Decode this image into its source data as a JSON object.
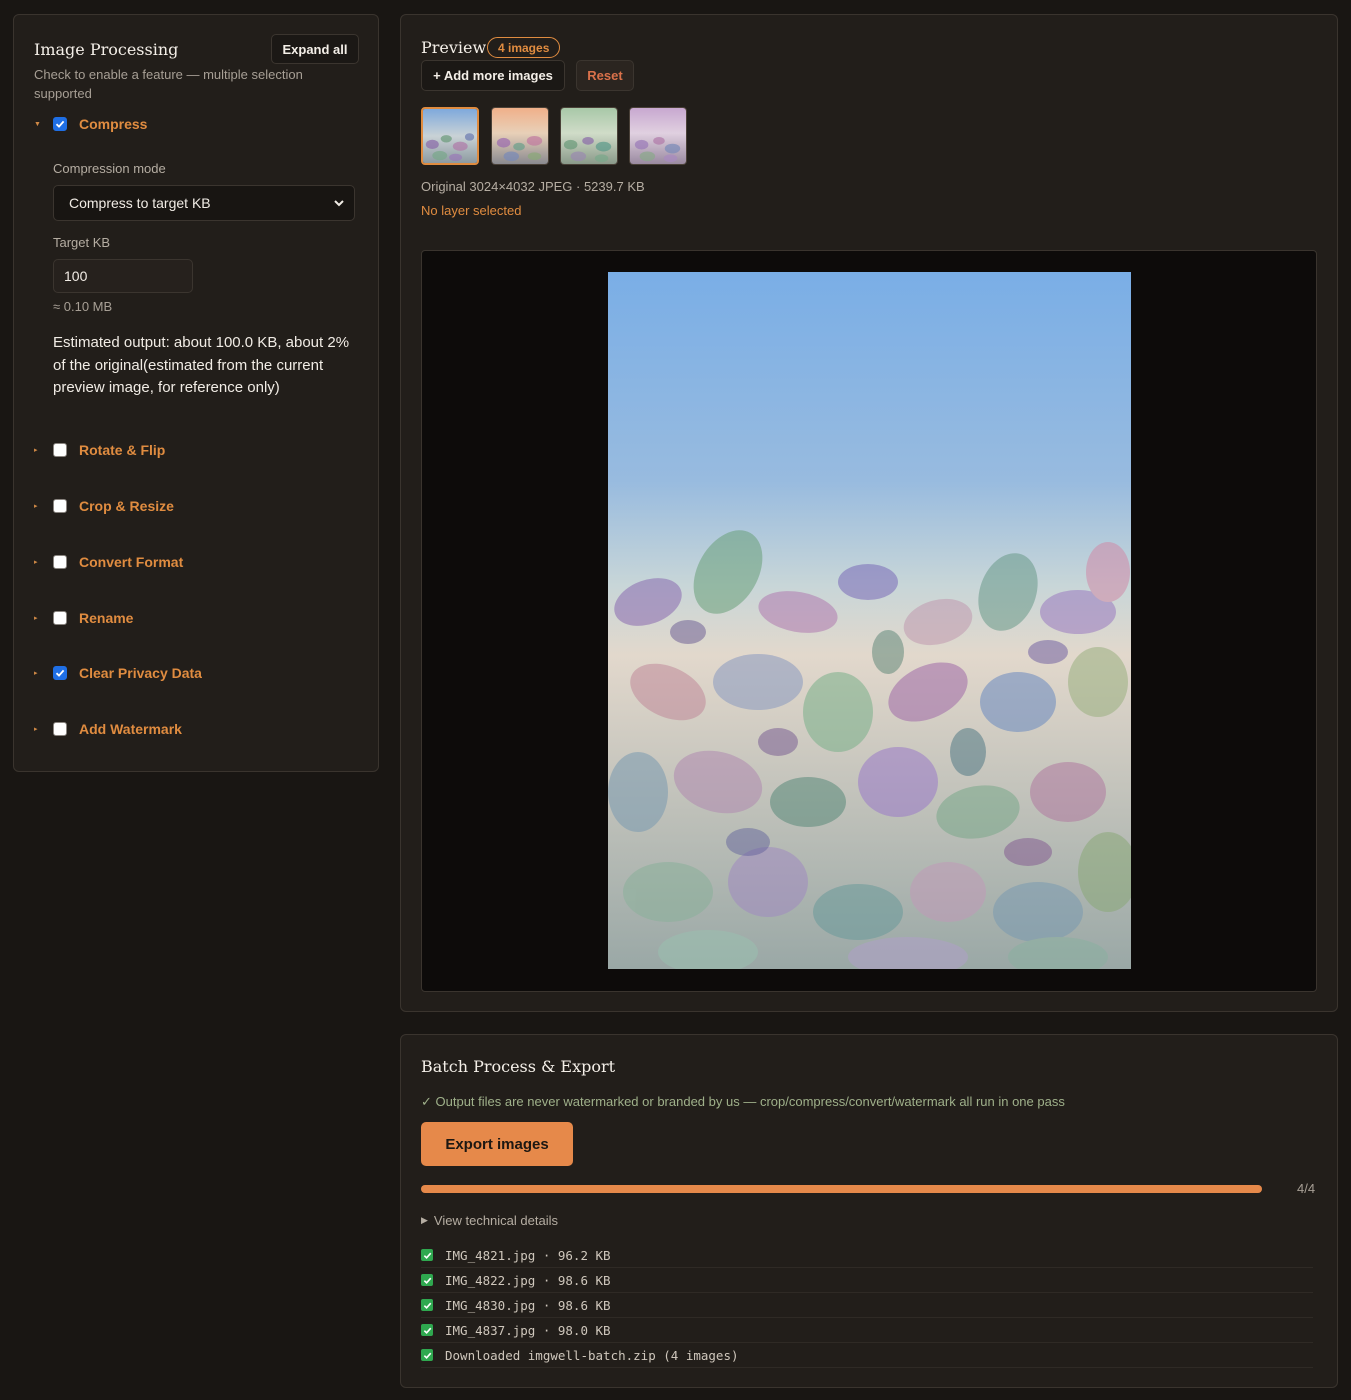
{
  "left_panel": {
    "title": "Image Processing",
    "expand_all_label": "Expand all",
    "hint": "Check to enable a feature — multiple selection supported",
    "compress": {
      "label": "Compress",
      "checked": true,
      "mode_label": "Compression mode",
      "mode_value": "Compress to target KB",
      "target_label": "Target KB",
      "target_value": "100",
      "mb_hint": "≈ 0.10 MB",
      "estimate": "Estimated output: about 100.0 KB, about 2% of the original(estimated from the current preview image, for reference only)"
    },
    "features": [
      {
        "label": "Rotate & Flip",
        "checked": false
      },
      {
        "label": "Crop & Resize",
        "checked": false
      },
      {
        "label": "Convert Format",
        "checked": false
      },
      {
        "label": "Rename",
        "checked": false
      },
      {
        "label": "Clear Privacy Data",
        "checked": true
      },
      {
        "label": "Add Watermark",
        "checked": false
      }
    ]
  },
  "preview": {
    "title": "Preview",
    "count_badge": "4 images",
    "add_more_label": "+ Add more images",
    "reset_label": "Reset",
    "original_info": "Original 3024×4032 JPEG · 5239.7 KB",
    "layer_info": "No layer selected"
  },
  "export": {
    "title": "Batch Process & Export",
    "note": "✓ Output files are never watermarked or branded by us — crop/compress/convert/watermark all run in one pass",
    "export_label": "Export images",
    "progress_value": 1.0,
    "progress_text": "4/4",
    "details_label": "View technical details",
    "log": [
      "IMG_4821.jpg · 96.2 KB",
      "IMG_4822.jpg · 98.6 KB",
      "IMG_4830.jpg · 98.6 KB",
      "IMG_4837.jpg · 98.0 KB",
      "Downloaded imgwell-batch.zip (4 images)"
    ]
  },
  "colors": {
    "accent": "#e08c40",
    "export_button": "#e6894a",
    "checkbox_checked": "#1f6fe5",
    "log_check": "#2fa84f"
  }
}
